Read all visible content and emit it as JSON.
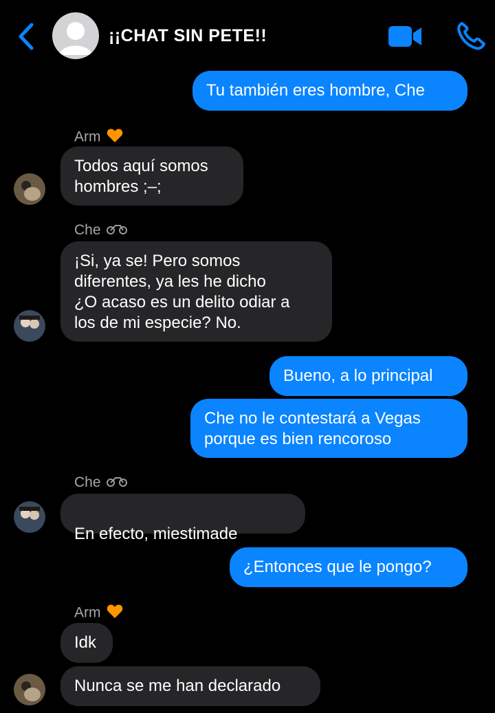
{
  "header": {
    "title": "¡¡CHAT SIN PETE!!",
    "icons": {
      "back": "chevron-left-icon",
      "video": "video-camera-icon",
      "call": "phone-icon"
    }
  },
  "colors": {
    "outgoing": "#0a84ff",
    "incoming": "#262628",
    "background": "#000000",
    "accent": "#0a84ff"
  },
  "messages": [
    {
      "text": "Tu también eres hombre, Che"
    },
    {
      "sender": "Arm",
      "text": "Todos aquí somos\nhombres ;–;"
    },
    {
      "sender": "Che",
      "text": "¡Si, ya se! Pero somos\ndiferentes, ya les he dicho\n¿O acaso es un delito odiar a\nlos de mi especie? No."
    },
    {
      "text": "Bueno, a lo principal"
    },
    {
      "text": "Che no le contestará a Vegas\nporque es bien rencoroso"
    },
    {
      "sender": "Che",
      "text": "En efecto, miestimade"
    },
    {
      "text": "¿Entonces que le pongo?"
    },
    {
      "sender": "Arm",
      "text": "Idk"
    },
    {
      "text": "Nunca se me han declarado"
    }
  ]
}
